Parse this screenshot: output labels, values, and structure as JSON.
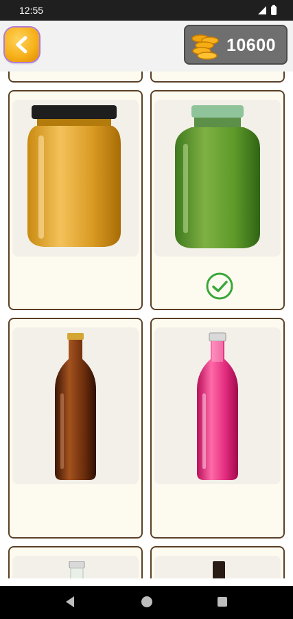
{
  "status_bar": {
    "time": "12:55",
    "icons": [
      "signal-icon",
      "battery-icon"
    ]
  },
  "header": {
    "back_icon": "chevron-left-icon",
    "coins_icon": "coin-stack-icon",
    "coins": "10600"
  },
  "products": [
    {
      "name": "honey-jar",
      "icon": "golden-jar",
      "selected": false
    },
    {
      "name": "green-jar",
      "icon": "green-jar",
      "selected": true,
      "status_icon": "check-circle-icon"
    },
    {
      "name": "brown-bottle",
      "icon": "brown-bottle",
      "selected": false
    },
    {
      "name": "pink-bottle",
      "icon": "pink-bottle",
      "selected": false
    },
    {
      "name": "clear-bottle",
      "icon": "clear-bottle",
      "selected": false
    },
    {
      "name": "dark-bottle",
      "icon": "dark-bottle",
      "selected": false
    }
  ],
  "colors": {
    "accent_check": "#3aa63a",
    "card_border": "#5a3f26",
    "card_bg": "#fdfbf0",
    "coins_panel": "#6f6f6f",
    "back_button": "#f7b21c"
  },
  "nav": {
    "icons": [
      "back-triangle-icon",
      "home-circle-icon",
      "recent-square-icon"
    ]
  }
}
